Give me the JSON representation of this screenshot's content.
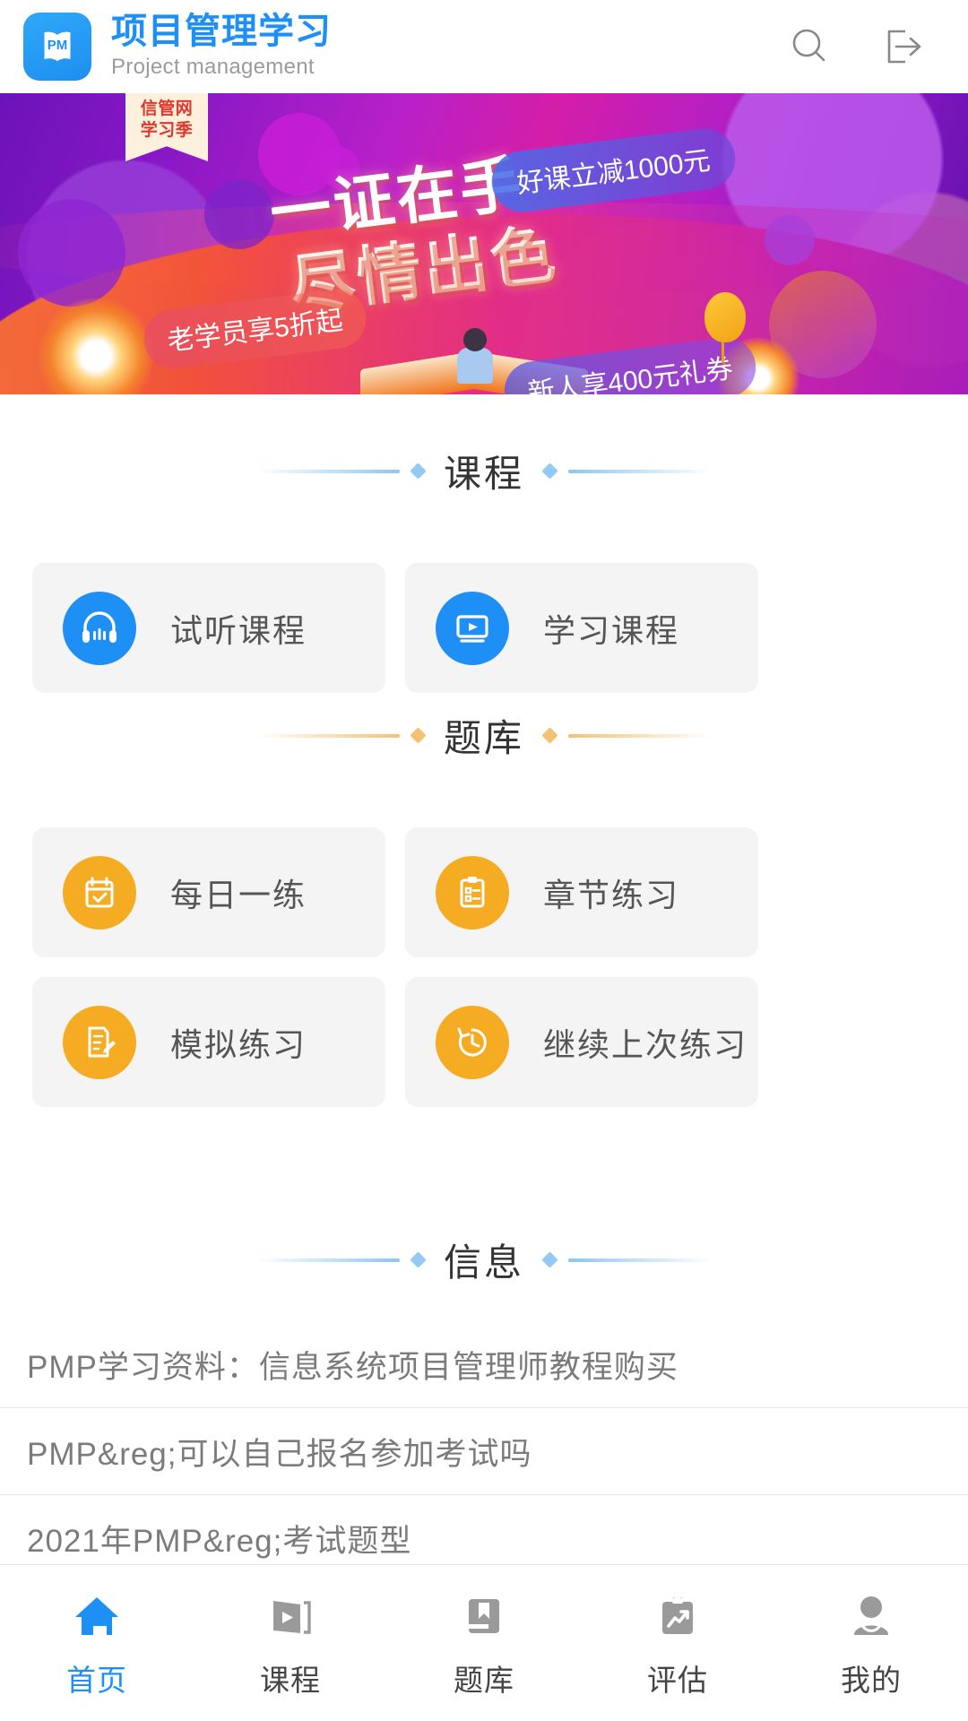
{
  "header": {
    "logo_text": "PM",
    "title": "项目管理学习",
    "subtitle": "Project management",
    "search_icon": "search-icon",
    "logout_icon": "logout-icon"
  },
  "banner": {
    "ribbon_line1": "信管网",
    "ribbon_line2": "学习季",
    "headline_line1": "一证在手",
    "headline_line2": "尽情出色",
    "promo_discount": "好课立减1000元",
    "promo_alumni": "老学员享5折起",
    "promo_newuser": "新人享400元礼券"
  },
  "sections": [
    {
      "id": "courses",
      "title": "课程",
      "accent": "#8fc6f2",
      "items": [
        {
          "label": "试听课程",
          "icon": "headphones-icon",
          "color": "#1e90f5"
        },
        {
          "label": "学习课程",
          "icon": "video-player-icon",
          "color": "#1e90f5"
        }
      ]
    },
    {
      "id": "question-bank",
      "title": "题库",
      "accent": "#f3c272",
      "items": [
        {
          "label": "每日一练",
          "icon": "calendar-check-icon",
          "color": "#f5ab22"
        },
        {
          "label": "章节练习",
          "icon": "clipboard-list-icon",
          "color": "#f5ab22"
        },
        {
          "label": "模拟练习",
          "icon": "document-pencil-icon",
          "color": "#f5ab22"
        },
        {
          "label": "继续上次练习",
          "icon": "clock-history-icon",
          "color": "#f5ab22"
        }
      ]
    },
    {
      "id": "information",
      "title": "信息",
      "accent": "#8fc6f2",
      "items": []
    }
  ],
  "info_list": [
    {
      "text": "PMP学习资料：信息系统项目管理师教程购买"
    },
    {
      "text": "PMP&reg;可以自己报名参加考试吗"
    },
    {
      "text": "2021年PMP&reg;考试题型"
    }
  ],
  "tabbar": {
    "active_color": "#1e90f5",
    "inactive_color": "#9a9a9a",
    "items": [
      {
        "label": "首页",
        "icon": "home-icon",
        "active": true
      },
      {
        "label": "课程",
        "icon": "video-icon",
        "active": false
      },
      {
        "label": "题库",
        "icon": "book-bookmark-icon",
        "active": false
      },
      {
        "label": "评估",
        "icon": "clipboard-chart-icon",
        "active": false
      },
      {
        "label": "我的",
        "icon": "user-icon",
        "active": false
      }
    ]
  }
}
